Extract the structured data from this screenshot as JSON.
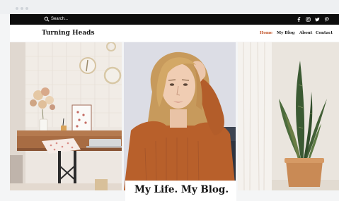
{
  "search": {
    "label": "Search..."
  },
  "site": {
    "title": "Turning Heads"
  },
  "nav": {
    "items": [
      {
        "label": "Home",
        "active": true
      },
      {
        "label": "My Blog",
        "active": false
      },
      {
        "label": "About",
        "active": false
      },
      {
        "label": "Contact",
        "active": false
      }
    ]
  },
  "social": [
    "facebook-icon",
    "instagram-icon",
    "twitter-icon",
    "pinterest-icon"
  ],
  "hero": {
    "title": "My Life. My Blog."
  },
  "colors": {
    "accent": "#c2552a",
    "topbar": "#0d0d0d"
  }
}
